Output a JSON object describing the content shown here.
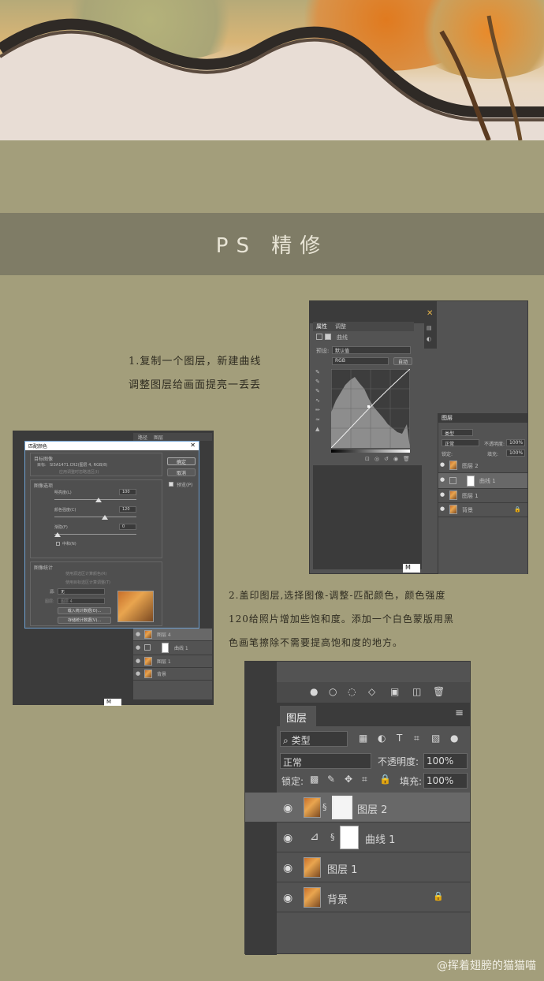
{
  "banner": {
    "title": "PS  精修"
  },
  "step1": {
    "line1": "1.复制一个图层，新建曲线",
    "line2": "调整图层给画面提亮一丢丢"
  },
  "step2": {
    "line1": "2.盖印图层,选择图像-调整-匹配颜色，颜色强度",
    "line2": "120给照片增加些饱和度。添加一个白色蒙版用黑",
    "line3": "色画笔擦除不需要提高饱和度的地方。"
  },
  "curves": {
    "tabs": [
      "属性",
      "调整"
    ],
    "title": "曲线",
    "preset_label": "预设:",
    "preset_value": "默认值",
    "channel_value": "RGB",
    "auto_btn": "自动",
    "zoom": "M"
  },
  "layers_small": {
    "tab": "图层",
    "filter": "类型",
    "mode": "正常",
    "opacity_label": "不透明度:",
    "opacity_value": "100%",
    "lock_label": "锁定:",
    "fill_label": "填充:",
    "fill_value": "100%",
    "layers": [
      "图层 2",
      "曲线 1",
      "图层 1",
      "背景"
    ]
  },
  "match_dialog": {
    "title": "匹配颜色",
    "target_section": "目标图像",
    "target_label": "目标:",
    "target_value": "SI3A1471.CR2(图层 4, RGB/8)",
    "ignore_selection": "应用调整时忽略选区(I)",
    "options_section": "图像选项",
    "luminance_label": "明亮度(L)",
    "luminance_value": "100",
    "intensity_label": "颜色强度(C)",
    "intensity_value": "120",
    "fade_label": "渐隐(F)",
    "fade_value": "0",
    "neutralize": "中和(N)",
    "stats_section": "图像统计",
    "use_source_sel": "使用源选区计算颜色(R)",
    "use_target_sel": "使用目标选区计算调整(T)",
    "source_label": "源:",
    "source_value": "无",
    "layer_label": "图层:",
    "layer_value": "图层 4",
    "load_stats": "载入统计数据(O)...",
    "save_stats": "存储统计数据(V)...",
    "ok": "确定",
    "cancel": "取消",
    "preview": "预览(P)",
    "bg_tabs": [
      "路径",
      "图层"
    ],
    "bg_layers": [
      "图层 4",
      "曲线 1",
      "图层 1",
      "背景"
    ],
    "zoom": "M"
  },
  "layers_big": {
    "tab": "图层",
    "filter": "类型",
    "mode": "正常",
    "opacity_label": "不透明度:",
    "opacity_value": "100%",
    "lock_label": "锁定:",
    "fill_label": "填充:",
    "fill_value": "100%",
    "layers": [
      "图层 2",
      "曲线 1",
      "图层 1",
      "背景"
    ]
  },
  "watermark": "@挥着翅膀的猫猫喵"
}
